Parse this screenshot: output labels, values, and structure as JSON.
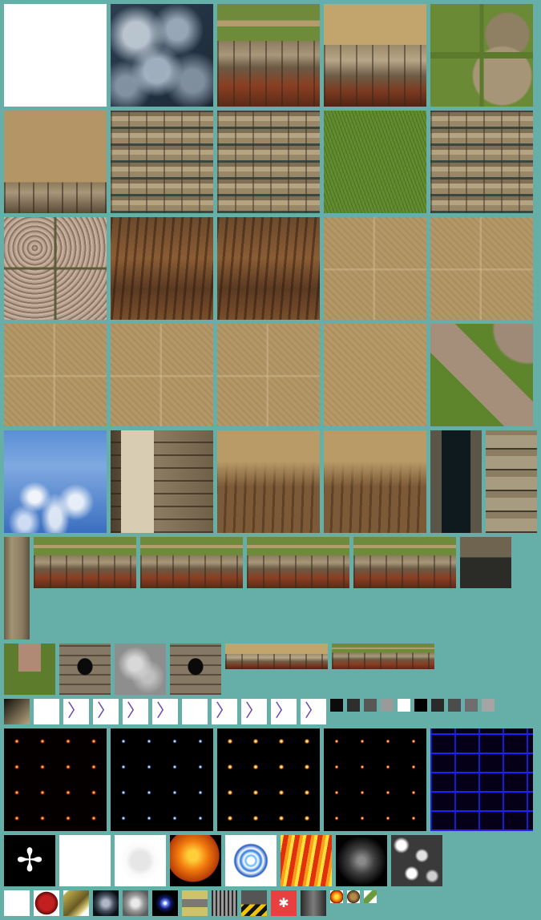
{
  "atlas": {
    "background_color": "#66afa8",
    "rows": [
      {
        "row": "terrain-row-1",
        "tiles": [
          "white",
          "smoke",
          "grasstop-stone",
          "drygrass-stone",
          "grass-slabs"
        ]
      },
      {
        "row": "terrain-row-2",
        "tiles": [
          "sand-stone",
          "stone",
          "stone",
          "grass",
          "stone"
        ]
      },
      {
        "row": "terrain-row-3",
        "tiles": [
          "slab4",
          "rock-brown",
          "rock-brown",
          "sand-faint-slab",
          "sand-faint-slab"
        ]
      },
      {
        "row": "terrain-row-4",
        "tiles": [
          "sand-faint-slab",
          "sand-faint-slab",
          "sand-faint-slab",
          "sand",
          "grass-path"
        ]
      },
      {
        "row": "terrain-row-5",
        "tiles": [
          "sky",
          "carved",
          "rock-sand",
          "rock-sand",
          "pillar-dark",
          "bricks-grey"
        ]
      },
      {
        "row": "strip-row",
        "tiles": [
          "tall-column",
          "grasstop-stone",
          "grasstop-stone",
          "grasstop-stone",
          "grasstop-stone",
          "dark-stone"
        ]
      },
      {
        "row": "detail-row",
        "tiles": [
          "plaza",
          "gate",
          "grey-cloud",
          "gate",
          "drygrass-stone",
          "grasstop-stone"
        ]
      },
      {
        "row": "sprite-row",
        "tiles": [
          "grad-square",
          "white",
          "white",
          "white",
          "white",
          "white",
          "white",
          "white",
          "white",
          "white",
          "white"
        ]
      },
      {
        "row": "effects-row",
        "tiles": [
          "fireframes",
          "blueframes",
          "explosion",
          "smallblast",
          "bluegrid"
        ]
      },
      {
        "row": "particles-row",
        "tiles": [
          "eagle",
          "white",
          "fuzz",
          "sun",
          "ring",
          "flames",
          "dark-smoke",
          "marble"
        ]
      },
      {
        "row": "icons-row",
        "tiles": [
          "white",
          "redrock",
          "goldrock",
          "bluehaze",
          "greyhaze",
          "bluestar",
          "ui-panel",
          "metal-panel",
          "hazard",
          "redicon",
          "darkmetal",
          "mini-fire",
          "mini-rock",
          "mini-leaf"
        ]
      }
    ],
    "swatch_colors": [
      "#0b0b0b",
      "#2e2e2e",
      "#575757",
      "#9a9a9a",
      "#ffffff",
      "#000000",
      "#2a2a2a",
      "#4c4c4c",
      "#6e6e6e",
      "#a5a5a5",
      "#ffffff"
    ],
    "brush_glyph": "〉",
    "eagle_glyph": "✢",
    "red_glyph": "✱"
  }
}
